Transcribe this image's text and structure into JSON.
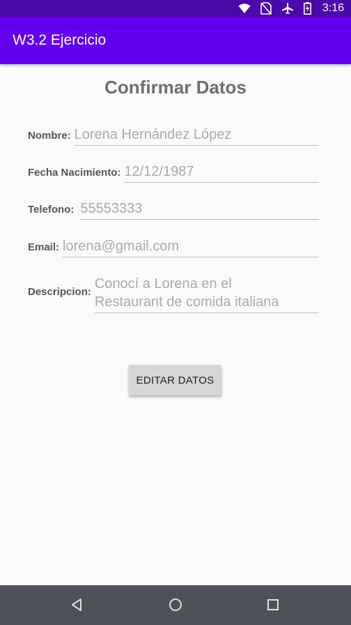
{
  "status_bar": {
    "time": "3:16",
    "icons": [
      "wifi-icon",
      "no-sim-icon",
      "airplane-icon",
      "battery-charging-icon"
    ]
  },
  "app_bar": {
    "title": "W3.2 Ejercicio"
  },
  "form": {
    "title": "Confirmar Datos",
    "fields": [
      {
        "label": "Nombre:",
        "value": "Lorena Hernández López"
      },
      {
        "label": "Fecha Nacimiento:",
        "value": "12/12/1987"
      },
      {
        "label": "Telefono:",
        "value": "55553333"
      },
      {
        "label": "Email:",
        "value": "lorena@gmail.com"
      },
      {
        "label": "Descripcion:",
        "value_line1": "Conocí a Lorena en el",
        "value_line2": "Restaurant de comida italiana"
      }
    ],
    "edit_button_label": "EDITAR DATOS"
  },
  "nav_bar": {
    "icons": [
      "back-icon",
      "home-icon",
      "recents-icon"
    ]
  },
  "colors": {
    "status_bar": "#4a0aa8",
    "app_bar": "#6200ee",
    "background": "#fafafa",
    "nav_bar": "#4d5258"
  }
}
